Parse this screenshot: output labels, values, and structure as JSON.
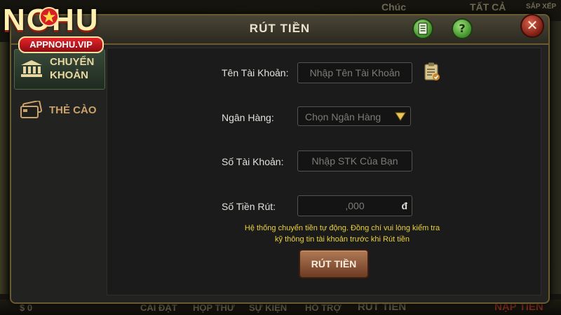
{
  "background": {
    "top_labels": [
      "Chúc",
      "TẤT CẢ",
      "SẮP XẾP"
    ],
    "bottom_labels": [
      "$ 0",
      "CÀI ĐẶT",
      "HỘP THƯ",
      "SỰ KIỆN",
      "HỖ TRỢ",
      "RÚT TIỀN",
      "NẠP TIỀN"
    ]
  },
  "logo": {
    "text": "NOHU",
    "badge": "APPNOHU.VIP"
  },
  "dialog": {
    "title": "RÚT TIỀN",
    "history_icon": "history-list-icon",
    "help_label": "?",
    "close_label": "✕"
  },
  "sidebar": {
    "items": [
      {
        "label": "CHUYỂN KHOẢN",
        "icon": "bank-icon",
        "active": true
      },
      {
        "label": "THẺ CÀO",
        "icon": "card-icon",
        "active": false
      }
    ]
  },
  "form": {
    "account_name": {
      "label": "Tên Tài Khoản:",
      "placeholder": "Nhập Tên Tài Khoản"
    },
    "bank": {
      "label": "Ngân Hàng:",
      "placeholder": "Chọn Ngân Hàng"
    },
    "account_number": {
      "label": "Số Tài Khoản:",
      "placeholder": "Nhập STK Của Bạn"
    },
    "amount": {
      "label": "Số Tiền Rút:",
      "placeholder": ",000",
      "currency": "đ"
    },
    "note_line1": "Hệ thống chuyển tiền tự động. Đồng chí vui lòng kiểm tra",
    "note_line2": "kỹ thông tin tài khoản trước khi Rút tiền",
    "submit_label": "RÚT TIỀN"
  },
  "colors": {
    "accent_green": "#3f8e2a",
    "close_red": "#7c1d12",
    "note_yellow": "#e9d23b",
    "button_brown": "#6d3b23"
  }
}
